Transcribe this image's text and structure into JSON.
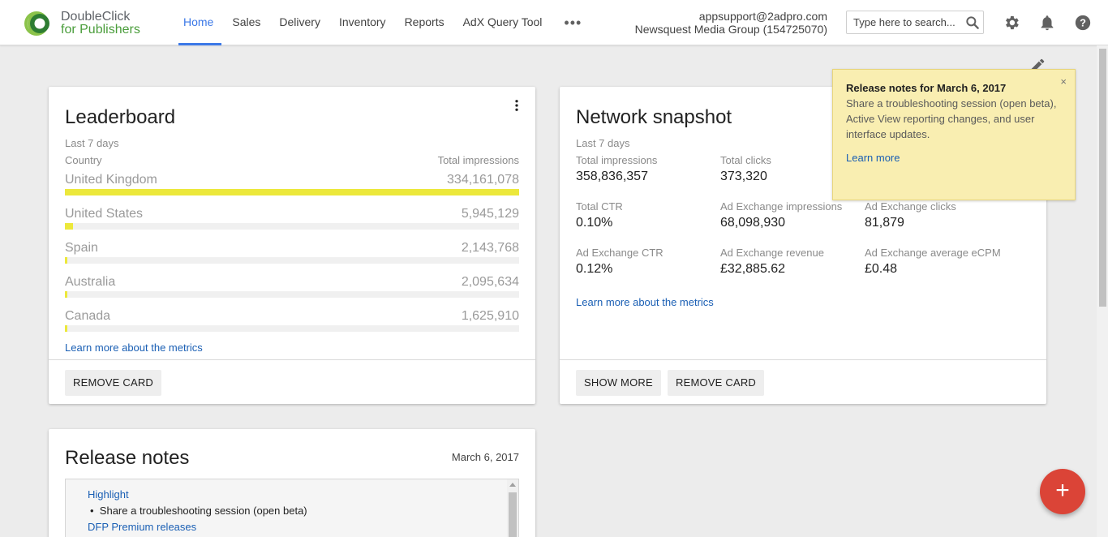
{
  "brand": {
    "line1": "DoubleClick",
    "line2": "for Publishers"
  },
  "nav": {
    "items": [
      {
        "label": "Home",
        "active": true
      },
      {
        "label": "Sales"
      },
      {
        "label": "Delivery"
      },
      {
        "label": "Inventory"
      },
      {
        "label": "Reports"
      },
      {
        "label": "AdX Query Tool"
      }
    ],
    "more": "•••"
  },
  "account": {
    "email": "appsupport@2adpro.com",
    "network": "Newsquest Media Group (154725070)"
  },
  "search": {
    "placeholder": "Type here to search..."
  },
  "header_icons": [
    "search-icon",
    "gear-icon",
    "bell-icon",
    "help-icon"
  ],
  "leaderboard": {
    "title": "Leaderboard",
    "period": "Last 7 days",
    "col_country": "Country",
    "col_metric": "Total impressions",
    "rows": [
      {
        "country": "United Kingdom",
        "value": "334,161,078",
        "share": 1.0
      },
      {
        "country": "United States",
        "value": "5,945,129",
        "share": 0.018
      },
      {
        "country": "Spain",
        "value": "2,143,768",
        "share": 0.006
      },
      {
        "country": "Australia",
        "value": "2,095,634",
        "share": 0.006
      },
      {
        "country": "Canada",
        "value": "1,625,910",
        "share": 0.005
      }
    ],
    "learn_more": "Learn more about the metrics",
    "remove": "REMOVE CARD"
  },
  "snapshot": {
    "title": "Network snapshot",
    "period": "Last 7 days",
    "metrics": [
      {
        "label": "Total impressions",
        "value": "358,836,357"
      },
      {
        "label": "Total clicks",
        "value": "373,320"
      },
      {
        "label": "Total CTR",
        "value": "0.10%"
      },
      {
        "label": "Ad Exchange impressions",
        "value": "68,098,930"
      },
      {
        "label": "Ad Exchange clicks",
        "value": "81,879"
      },
      {
        "label": "Ad Exchange CTR",
        "value": "0.12%"
      },
      {
        "label": "Ad Exchange revenue",
        "value": "£32,885.62"
      },
      {
        "label": "Ad Exchange average eCPM",
        "value": "£0.48"
      }
    ],
    "learn_more": "Learn more about the metrics",
    "show_more": "SHOW MORE",
    "remove": "REMOVE CARD"
  },
  "notice": {
    "title": "Release notes for March 6, 2017",
    "body": "Share a troubleshooting session (open beta), Active View reporting changes, and user interface updates.",
    "link": "Learn more",
    "close": "×"
  },
  "release_notes": {
    "title": "Release notes",
    "date": "March 6, 2017",
    "highlight": "Highlight",
    "bullet": "Share a troubleshooting session (open beta)",
    "section": "DFP Premium releases"
  },
  "fab": "+",
  "colors": {
    "accent": "#3b78e7",
    "bar": "#ece83b",
    "fab": "#db4437",
    "notice_bg": "#f9eeb1"
  }
}
